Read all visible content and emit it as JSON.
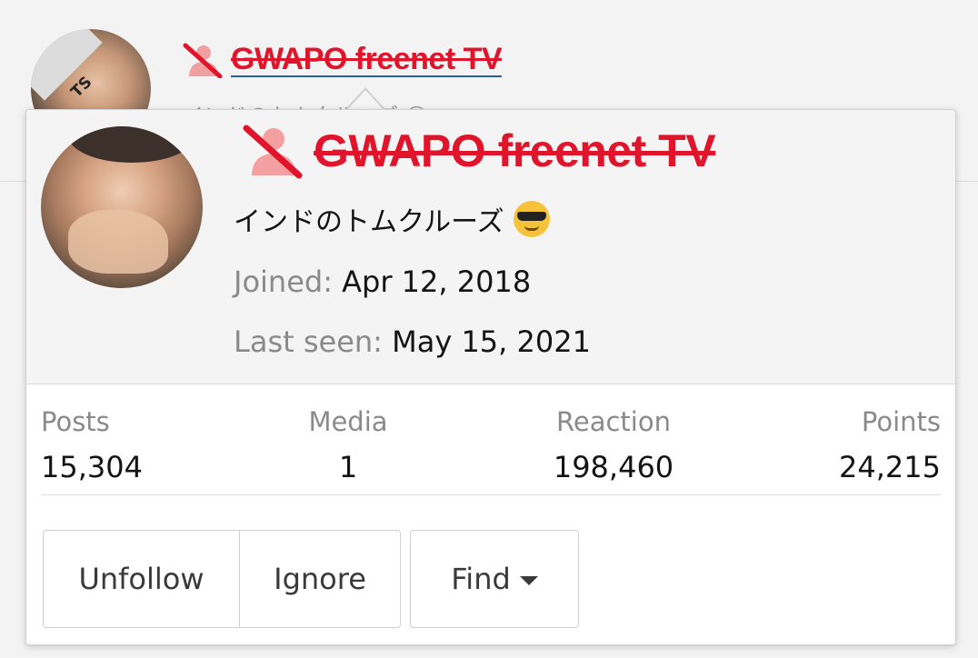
{
  "background": {
    "avatar_badge": "TS",
    "username": "GWAPO freenet TV",
    "subtitle": "インドのトムクルーズ 😎",
    "bottom_text": ""
  },
  "card": {
    "username": "GWAPO freenet TV",
    "user_title": "インドのトムクルーズ",
    "user_title_emoji": "smiling-face-with-sunglasses",
    "joined_label": "Joined:",
    "joined_value": "Apr 12, 2018",
    "last_seen_label": "Last seen:",
    "last_seen_value": "May 15, 2021",
    "name_color": "#e0142a",
    "banned_icon": "banned-user-icon"
  },
  "stats": {
    "posts_label": "Posts",
    "posts_value": "15,304",
    "media_label": "Media",
    "media_value": "1",
    "reaction_label": "Reaction",
    "reaction_value": "198,460",
    "points_label": "Points",
    "points_value": "24,215"
  },
  "actions": {
    "unfollow_label": "Unfollow",
    "ignore_label": "Ignore",
    "find_label": "Find"
  }
}
